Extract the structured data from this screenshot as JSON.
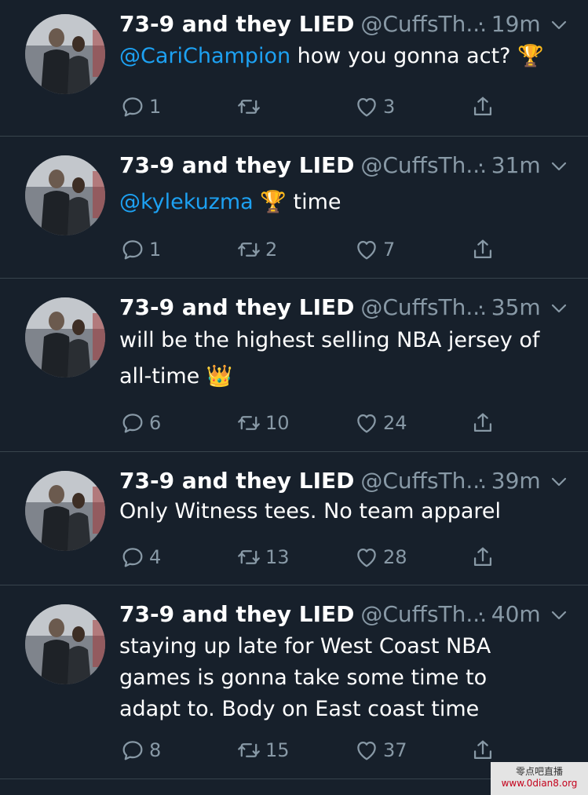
{
  "tweets": [
    {
      "name": "73-9 and they LIED",
      "handle": "@CuffsTh...",
      "time": "· 19m",
      "mention": "@CariChampion",
      "text": " how you gonna act? 🏆",
      "replies": "1",
      "retweets": "",
      "likes": "3"
    },
    {
      "name": "73-9 and they LIED",
      "handle": "@CuffsTh...",
      "time": "· 31m",
      "mention": "@kylekuzma",
      "text": " 🏆 time",
      "replies": "1",
      "retweets": "2",
      "likes": "7"
    },
    {
      "name": "73-9 and they LIED",
      "handle": "@CuffsTh...",
      "time": "· 35m",
      "mention": "",
      "text": "will be the highest selling NBA jersey of all-time 👑",
      "replies": "6",
      "retweets": "10",
      "likes": "24"
    },
    {
      "name": "73-9 and they LIED",
      "handle": "@CuffsTh...",
      "time": "· 39m",
      "mention": "",
      "text": "Only Witness tees. No team apparel",
      "replies": "4",
      "retweets": "13",
      "likes": "28"
    },
    {
      "name": "73-9 and they LIED",
      "handle": "@CuffsTh...",
      "time": "· 40m",
      "mention": "",
      "text": "staying up late for West Coast NBA games is gonna take some time to adapt to. Body on East coast time",
      "replies": "8",
      "retweets": "15",
      "likes": "37"
    }
  ],
  "watermark": {
    "line1": "零点吧直播",
    "line2": "www.0dian8.org"
  },
  "colors": {
    "background": "#17202b",
    "mention": "#1da1f2",
    "muted": "#8899a6",
    "divider": "#38444d"
  }
}
